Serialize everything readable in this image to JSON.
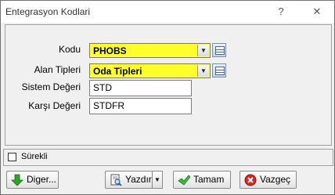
{
  "window": {
    "title": "Entegrasyon Kodlari",
    "help_glyph": "?",
    "close_glyph": "✕"
  },
  "form": {
    "kodu": {
      "label": "Kodu",
      "value": "PHOBS"
    },
    "alan_tipleri": {
      "label": "Alan Tipleri",
      "value": "Oda Tipleri"
    },
    "sistem_degeri": {
      "label": "Sistem Değeri",
      "value": "STD"
    },
    "karsi_degeri": {
      "label": "Karşı Değeri",
      "value": "STDFR"
    }
  },
  "surekli": {
    "label": "Sürekli",
    "checked": false
  },
  "buttons": {
    "diger": {
      "label": "Diger...",
      "icon": "green-down-arrow-icon"
    },
    "yazdir": {
      "label": "Yazdır",
      "icon": "print-preview-icon"
    },
    "tamam": {
      "label": "Tamam",
      "icon": "green-check-icon"
    },
    "vazgec": {
      "label": "Vazgeç",
      "icon": "red-cancel-icon"
    }
  },
  "colors": {
    "required_field": "#ffff2a",
    "dialog_bg": "#f0f0f0"
  }
}
